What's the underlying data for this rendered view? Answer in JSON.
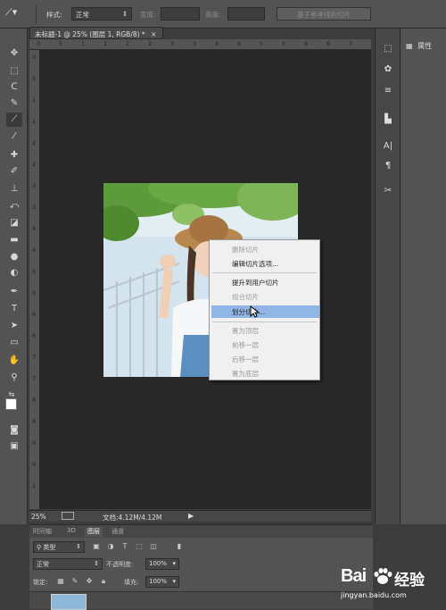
{
  "options_bar": {
    "style_label": "样式:",
    "style_value": "正常",
    "width_label": "宽度:",
    "height_label": "高度:",
    "button_label": "基于参考线的切片"
  },
  "document": {
    "tab_title": "未标题-1 @ 25% (图层 1, RGB/8) *",
    "close_glyph": "×",
    "ruler_top": [
      "0",
      "5",
      "1",
      "1",
      "2",
      "2",
      "3",
      "3",
      "4",
      "4",
      "5",
      "5",
      "6",
      "6",
      "7"
    ],
    "ruler_left": [
      "0",
      "5",
      "1",
      "1",
      "2",
      "2",
      "3",
      "3",
      "4",
      "4",
      "5",
      "5",
      "6",
      "6",
      "7",
      "7",
      "8",
      "8",
      "9",
      "9",
      "1"
    ]
  },
  "context_menu": {
    "items": [
      {
        "label": "删除切片",
        "enabled": false
      },
      {
        "label": "编辑切片选项...",
        "enabled": true
      },
      {
        "label": "提升到用户切片",
        "enabled": true
      },
      {
        "label": "组合切片",
        "enabled": false
      },
      {
        "label": "划分切片...",
        "enabled": true,
        "highlighted": true
      },
      {
        "label": "置为顶层",
        "enabled": false
      },
      {
        "label": "前移一层",
        "enabled": false
      },
      {
        "label": "后移一层",
        "enabled": false
      },
      {
        "label": "置为底层",
        "enabled": false
      }
    ]
  },
  "status_bar": {
    "zoom": "25%",
    "doc_info": "文档:4.12M/4.12M"
  },
  "right_panel": {
    "properties_label": "属性"
  },
  "layers_panel": {
    "tabs": [
      "时间轴",
      "3D",
      "图层",
      "通道"
    ],
    "active_tab": "图层",
    "kind_filter": "类型",
    "blend_mode": "正常",
    "opacity_label": "不透明度:",
    "opacity_value": "100%",
    "lock_label": "锁定:",
    "fill_label": "填充:",
    "fill_value": "100%"
  },
  "watermark": {
    "brand": "Bai",
    "brand_cn": "经验",
    "url": "jingyan.baidu.com"
  },
  "colors": {
    "ui_dark": "#282828",
    "panel": "#535353",
    "menu_highlight": "#8fb6e4"
  }
}
